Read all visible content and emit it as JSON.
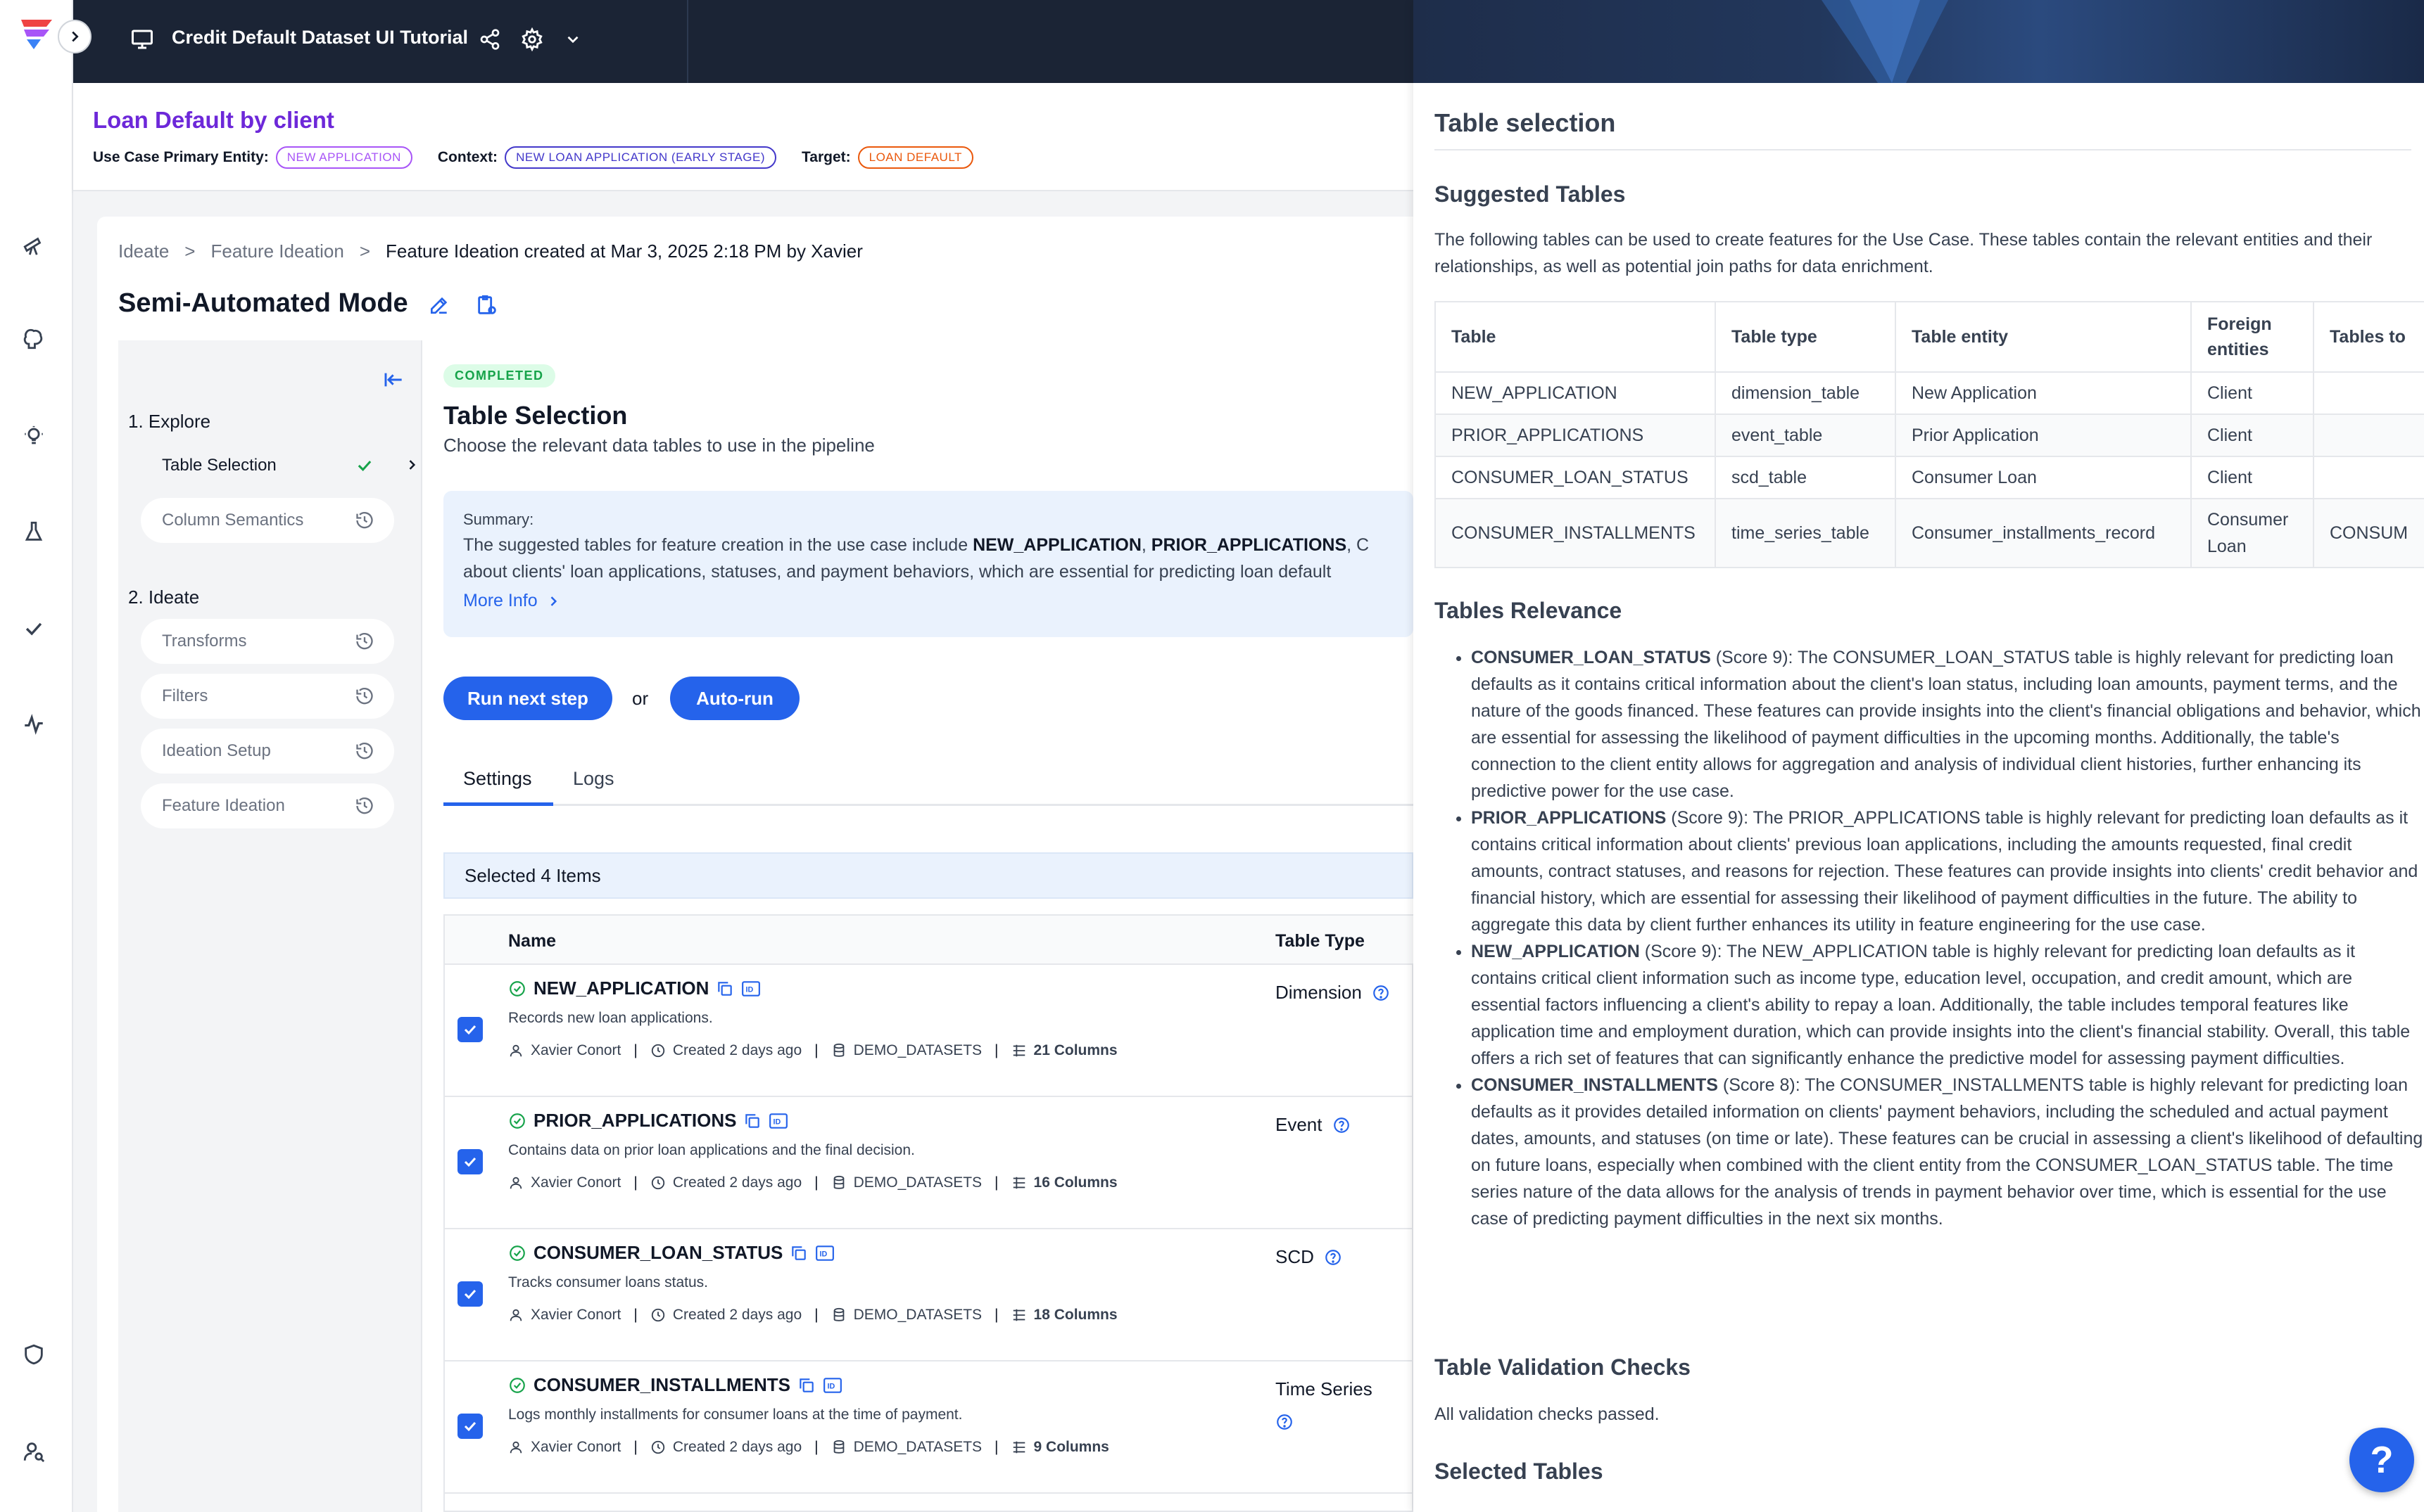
{
  "app": {
    "title": "Credit Default Dataset UI Tutorial"
  },
  "use_case": {
    "title": "Loan Default by client",
    "primary_entity_label": "Use Case Primary Entity:",
    "primary_entity": "NEW APPLICATION",
    "context_label": "Context:",
    "context": "NEW LOAN APPLICATION (EARLY STAGE)",
    "target_label": "Target:",
    "target": "LOAN DEFAULT"
  },
  "breadcrumb": [
    "Ideate",
    "Feature Ideation",
    "Feature Ideation created at Mar 3, 2025 2:18 PM by Xavier"
  ],
  "breadcrumb_sep": ">",
  "mode_title": "Semi-Automated Mode",
  "steps": {
    "explore_label": "1. Explore",
    "explore_items": [
      "Table Selection",
      "Column Semantics"
    ],
    "ideate_label": "2. Ideate",
    "ideate_items": [
      "Transforms",
      "Filters",
      "Ideation Setup",
      "Feature Ideation"
    ]
  },
  "center": {
    "status": "COMPLETED",
    "title": "Table Selection",
    "subtitle": "Choose the relevant data tables to use in the pipeline",
    "summary_label": "Summary:",
    "summary_line1_pre": "The suggested tables for feature creation in the use case include ",
    "summary_line1_b1": "NEW_APPLICATION",
    "summary_line1_mid": ", ",
    "summary_line1_b2": "PRIOR_APPLICATIONS",
    "summary_line1_post": ", C",
    "summary_line2": "about clients' loan applications, statuses, and payment behaviors, which are essential for predicting loan default",
    "more_info": "More Info",
    "run_next": "Run next step",
    "or": "or",
    "auto_run": "Auto-run",
    "tabs": [
      "Settings",
      "Logs"
    ],
    "selected_count": "Selected 4 Items",
    "col_name": "Name",
    "col_type": "Table Type",
    "rows": [
      {
        "name": "NEW_APPLICATION",
        "desc": "Records new loan applications.",
        "owner": "Xavier Conort",
        "created": "Created 2 days ago",
        "source": "DEMO_DATASETS",
        "columns": "21 Columns",
        "type": "Dimension"
      },
      {
        "name": "PRIOR_APPLICATIONS",
        "desc": "Contains data on prior loan applications and the final decision.",
        "owner": "Xavier Conort",
        "created": "Created 2 days ago",
        "source": "DEMO_DATASETS",
        "columns": "16 Columns",
        "type": "Event"
      },
      {
        "name": "CONSUMER_LOAN_STATUS",
        "desc": "Tracks consumer loans status.",
        "owner": "Xavier Conort",
        "created": "Created 2 days ago",
        "source": "DEMO_DATASETS",
        "columns": "18 Columns",
        "type": "SCD"
      },
      {
        "name": "CONSUMER_INSTALLMENTS",
        "desc": "Logs monthly installments for consumer loans at the time of payment.",
        "owner": "Xavier Conort",
        "created": "Created 2 days ago",
        "source": "DEMO_DATASETS",
        "columns": "9 Columns",
        "type": "Time Series"
      }
    ]
  },
  "panel": {
    "title": "Table selection",
    "suggested_heading": "Suggested Tables",
    "suggested_text": "The following tables can be used to create features for the Use Case. These tables contain the relevant entities and their relationships, as well as potential join paths for data enrichment.",
    "table_headers": [
      "Table",
      "Table type",
      "Table entity",
      "Foreign entities",
      "Tables to"
    ],
    "table_rows": [
      [
        "NEW_APPLICATION",
        "dimension_table",
        "New Application",
        "Client",
        ""
      ],
      [
        "PRIOR_APPLICATIONS",
        "event_table",
        "Prior Application",
        "Client",
        ""
      ],
      [
        "CONSUMER_LOAN_STATUS",
        "scd_table",
        "Consumer Loan",
        "Client",
        ""
      ],
      [
        "CONSUMER_INSTALLMENTS",
        "time_series_table",
        "Consumer_installments_record",
        "Consumer Loan",
        "CONSUM"
      ]
    ],
    "relevance_heading": "Tables Relevance",
    "relevance": [
      {
        "name": "CONSUMER_LOAN_STATUS",
        "score": " (Score 9)",
        "text": ": The CONSUMER_LOAN_STATUS table is highly relevant for predicting loan defaults as it contains critical information about the client's loan status, including loan amounts, payment terms, and the nature of the goods financed. These features can provide insights into the client's financial obligations and behavior, which are essential for assessing the likelihood of payment difficulties in the upcoming months. Additionally, the table's connection to the client entity allows for aggregation and analysis of individual client histories, further enhancing its predictive power for the use case."
      },
      {
        "name": "PRIOR_APPLICATIONS",
        "score": " (Score 9)",
        "text": ": The PRIOR_APPLICATIONS table is highly relevant for predicting loan defaults as it contains critical information about clients' previous loan applications, including the amounts requested, final credit amounts, contract statuses, and reasons for rejection. These features can provide insights into clients' credit behavior and financial history, which are essential for assessing their likelihood of payment difficulties in the future. The ability to aggregate this data by client further enhances its utility in feature engineering for the use case."
      },
      {
        "name": "NEW_APPLICATION",
        "score": " (Score 9)",
        "text": ": The NEW_APPLICATION table is highly relevant for predicting loan defaults as it contains critical client information such as income type, education level, occupation, and credit amount, which are essential factors influencing a client's ability to repay a loan. Additionally, the table includes temporal features like application time and employment duration, which can provide insights into the client's financial stability. Overall, this table offers a rich set of features that can significantly enhance the predictive model for assessing payment difficulties."
      },
      {
        "name": "CONSUMER_INSTALLMENTS",
        "score": " (Score 8)",
        "text": ": The CONSUMER_INSTALLMENTS table is highly relevant for predicting loan defaults as it provides detailed information on clients' payment behaviors, including the scheduled and actual payment dates, amounts, and statuses (on time or late). These features can be crucial in assessing a client's likelihood of defaulting on future loans, especially when combined with the client entity from the CONSUMER_LOAN_STATUS table. The time series nature of the data allows for the analysis of trends in payment behavior over time, which is essential for the use case of predicting payment difficulties in the next six months."
      }
    ],
    "validation_heading": "Table Validation Checks",
    "validation_text": "All validation checks passed.",
    "selected_heading": "Selected Tables"
  },
  "help_label": "?"
}
